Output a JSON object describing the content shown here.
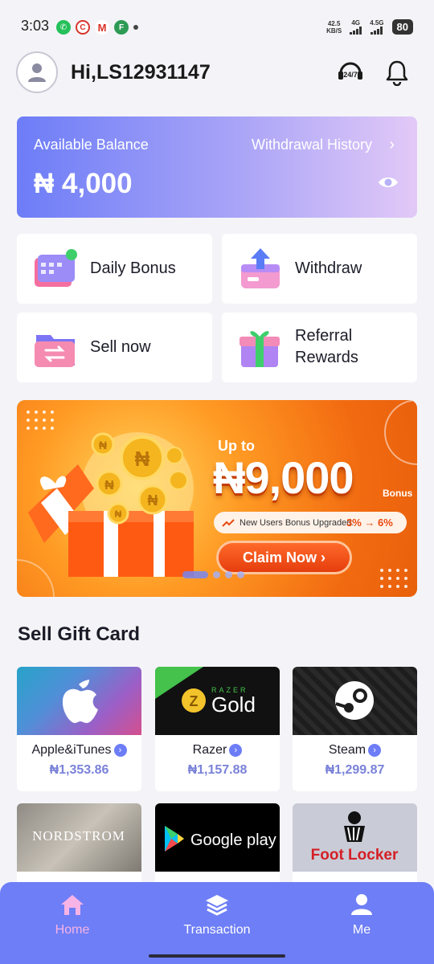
{
  "status_bar": {
    "time": "3:03",
    "net_speed_value": "42.5",
    "net_speed_unit": "KB/S",
    "signal1": "4G",
    "signal2": "4.5G",
    "battery": "80"
  },
  "header": {
    "greeting": "Hi,LS12931147",
    "support_icon_text": "24/7"
  },
  "balance": {
    "label": "Available Balance",
    "amount": "₦ 4,000",
    "history_link": "Withdrawal History"
  },
  "actions": [
    {
      "label": "Daily Bonus",
      "icon": "calendar-gift-icon"
    },
    {
      "label": "Withdraw",
      "icon": "withdraw-box-icon"
    },
    {
      "label": "Sell now",
      "icon": "exchange-folder-icon"
    },
    {
      "label": "Referral\nRewards",
      "icon": "gift-box-icon"
    }
  ],
  "banner": {
    "up_to": "Up to",
    "amount": "₦9,000",
    "bonus": "Bonus",
    "pill_text": "New Users Bonus Upgraded:",
    "pill_rate": "3% → 6%",
    "cta": "Claim Now",
    "carousel_count": 4,
    "carousel_active": 0
  },
  "section_title": "Sell Gift Card",
  "gift_cards": [
    {
      "name": "Apple&iTunes",
      "price": "₦1,353.86"
    },
    {
      "name": "Razer",
      "price": "₦1,157.88",
      "logo_top": "RAZER",
      "logo_main": "Gold"
    },
    {
      "name": "Steam",
      "price": "₦1,299.87"
    },
    {
      "name": "Nordstrom",
      "logo": "NORDSTROM"
    },
    {
      "name": "Google play",
      "logo": "Google play"
    },
    {
      "name": "Foot Locker",
      "logo": "Foot Locker"
    }
  ],
  "nav": {
    "home": "Home",
    "transaction": "Transaction",
    "me": "Me"
  },
  "colors": {
    "accent": "#6e7ef6",
    "price": "#7a82d8",
    "home_active": "#f7b3e6"
  }
}
